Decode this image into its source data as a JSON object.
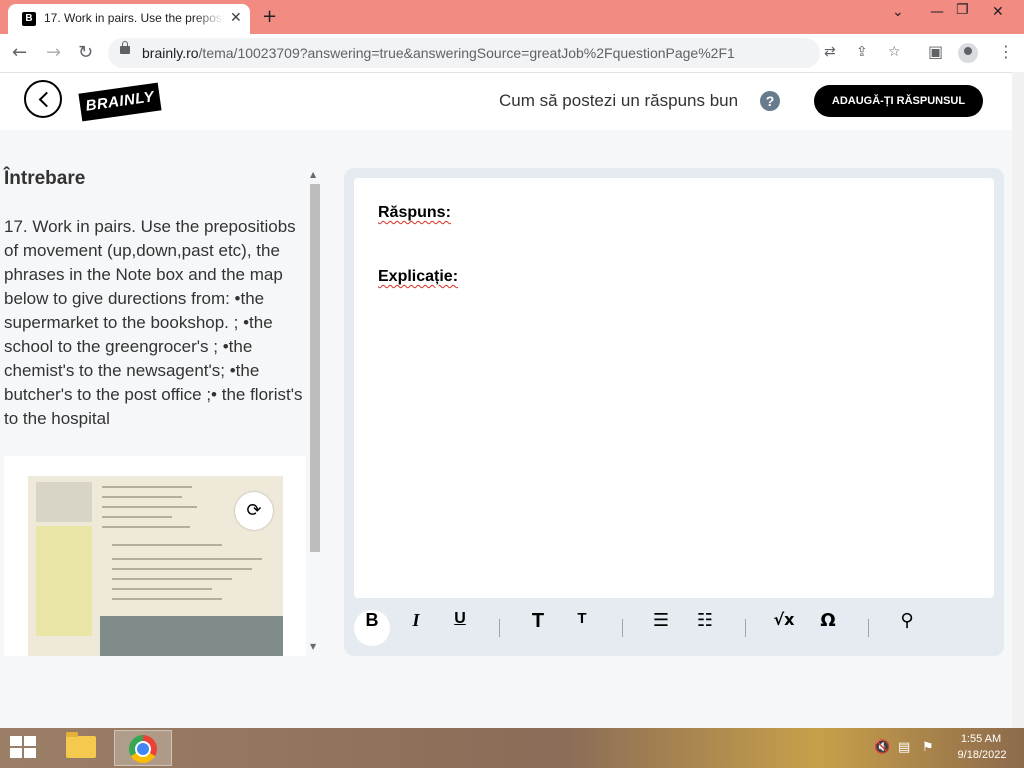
{
  "browser": {
    "tab_title": "17. Work in pairs. Use the prepositiobs",
    "tab_favicon": "B",
    "url_host": "brainly.ro",
    "url_path": "/tema/10023709?answering=true&answeringSource=greatJob%2FquestionPage%2F1"
  },
  "header": {
    "logo": "BRAINLY",
    "howto_text": "Cum să postezi un răspuns bun",
    "help_symbol": "?",
    "add_answer_label": "ADAUGĂ-ȚI RĂSPUNSUL"
  },
  "question": {
    "heading": "Întrebare",
    "text": "17. Work in pairs. Use the prepositiobs of movement (up,down,past etc), the phrases in the Note box and the map below to give durections from: •the supermarket to the bookshop. ; •the school to the greengrocer's ; •the chemist's to the newsagent's; •the butcher's to the post office ;• the florist's to the hospital"
  },
  "editor": {
    "answer_label": "Răspuns:",
    "explanation_label": "Explicație:",
    "toolbar": {
      "bold": "B",
      "italic": "I",
      "underline": "U",
      "heading_large": "T",
      "heading_small": "T",
      "sqrt": "√x",
      "omega": "Ω"
    }
  },
  "taskbar": {
    "time": "1:55 AM",
    "date": "9/18/2022"
  },
  "icons": {
    "tab_close": "close-icon",
    "new_tab": "plus-icon",
    "back": "arrow-left-icon",
    "forward": "arrow-right-icon",
    "reload": "reload-icon",
    "translate": "translate-icon",
    "share": "share-icon",
    "bookmark": "star-icon",
    "sidebar": "sidebar-icon",
    "profile": "profile-icon",
    "menu": "kebab-menu-icon",
    "rotate": "rotate-image-icon",
    "ordered_list": "ordered-list-icon",
    "bullet_list": "bullet-list-icon",
    "attachment": "paperclip-icon"
  },
  "colors": {
    "tabbar": "#f28b82",
    "primary_button": "#000000",
    "editor_bg": "#e5ebf1",
    "help_icon": "#687b8c",
    "spellcheck": "#d93025"
  }
}
